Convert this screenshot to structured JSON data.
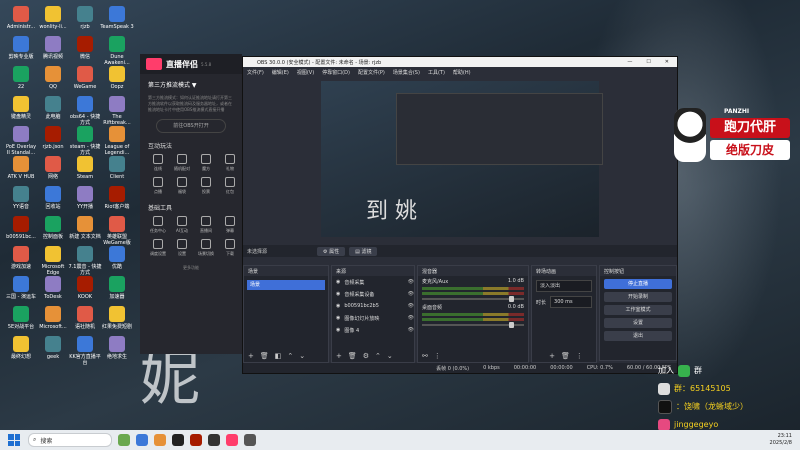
{
  "desktop": {
    "col1": [
      "Administr...",
      "剪映专业版",
      "22",
      "键盘精灵",
      "PoE Overlay II Standal...",
      "ATK V HUB",
      "YY语音",
      "b00591bc...",
      "游戏加速",
      "三国 - 演运车",
      "5E对战平台",
      "最终幻想"
    ],
    "col2": [
      "wonlity-li...",
      "腾讯视频",
      "QQ",
      "此电脑",
      "rjzb.json",
      "网络",
      "回收站",
      "控制面板",
      "Microsoft Edge",
      "ToDesk",
      "Microsoft...",
      "geek"
    ],
    "col3": [
      "rjzb",
      "微信",
      "WeGame",
      "obs64 - 快捷方式",
      "steam - 快捷方式",
      "Steam",
      "YY开播",
      "新建 文本文档",
      "7.1震音 - 快捷方式",
      "KOOK",
      "语社随机",
      "KK官方直播平台"
    ],
    "col4": [
      "TeamSpeak 3",
      "Dune Awakeni...",
      "Oopz",
      "The Riftbreak...",
      "League of Legendi...",
      "Client",
      "Riot客户端",
      "英雄联盟 WeGame版",
      "优酷",
      "加速器",
      "红果免费短剧",
      "绝地求生"
    ]
  },
  "wallpaper_text": "妮",
  "zhibo": {
    "title": "直播伴侣",
    "version": "5.5.8",
    "mode": "第三方推流模式 ▼",
    "desc": "第三方推流模式：如何认证推流地址请打开第三方推流软件以获取推流码及服务器地址，或者在推流地址卡片中使用OBS推流模式直接开播",
    "open_btn": "前往OBS开打开",
    "section1": "互动玩法",
    "interact": [
      "连线",
      "随机配对",
      "魔方",
      "礼物",
      "点播",
      "福袋",
      "投票",
      "红包"
    ],
    "section2": "基础工具",
    "tools": [
      "任务中心",
      "AI互动",
      "直播间",
      "弹幕",
      "调度设置",
      "设置",
      "场景切换",
      "下载"
    ],
    "more": "更多功能"
  },
  "obs": {
    "window_title": "OBS 30.0.0 (安全模式) - 配置文件: 未命名 - 场景: rjzb",
    "menu": [
      "文件(F)",
      "编辑(E)",
      "视图(V)",
      "停靠窗口(D)",
      "配置文件(P)",
      "场景集合(S)",
      "工具(T)",
      "帮助(H)"
    ],
    "no_source": "未选择源",
    "props_btn": "属性",
    "filters_btn": "滤镜",
    "preview_text": "到 姚",
    "scenes": {
      "title": "场景",
      "items": [
        "场景"
      ]
    },
    "sources": {
      "title": "来源",
      "items": [
        "音频采集",
        "音频采集设备",
        "b00591bc2b5",
        "图像幻灯片放映",
        "图像 4"
      ]
    },
    "mixer": {
      "title": "混音器",
      "channels": [
        {
          "name": "麦克风/Aux",
          "db": "1.0 dB"
        },
        {
          "name": "桌面音频",
          "db": "0.0 dB"
        }
      ]
    },
    "transitions": {
      "title": "转场动画",
      "type": "淡入淡出",
      "duration_label": "时长",
      "duration": "300 ms"
    },
    "controls": {
      "title": "控制按钮",
      "start_stream": "停止直播",
      "start_record": "开始录制",
      "studio_mode": "工作室模式",
      "settings": "设置",
      "exit": "退出"
    },
    "status": {
      "frames": "丢帧 0 (0.0%)",
      "kbps": "0 kbps",
      "live_time": "00:00:00",
      "rec_time": "00:00:00",
      "cpu": "CPU: 0.7%",
      "fps": "60.00 / 60.00 FPS"
    }
  },
  "promo": {
    "brand": "PANZHI",
    "line1": "跑刀代肝",
    "line2": "绝版刀皮"
  },
  "contact": {
    "line1": "加入",
    "line2": "群",
    "qq": "群：65145105",
    "douyin": "：饶啸（龙蜥域少）",
    "id": "jinggegeyo"
  },
  "taskbar": {
    "search": "搜索",
    "time": "23:11",
    "date": "2025/2/8"
  },
  "colors": {
    "accent": "#3f6fd8",
    "promo_red": "#c8101a"
  }
}
